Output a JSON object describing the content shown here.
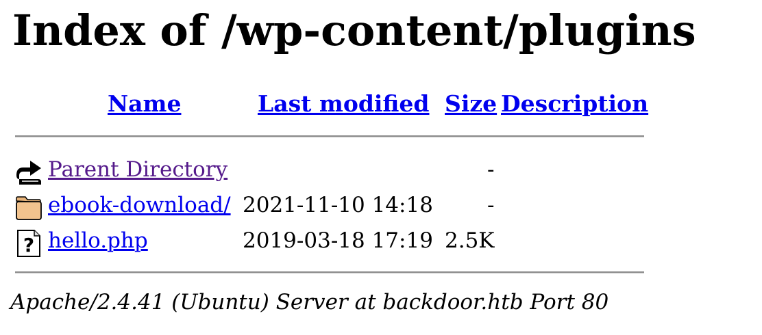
{
  "page": {
    "title": "Index of /wp-content/plugins"
  },
  "columns": {
    "name": "Name",
    "last_modified": "Last modified",
    "size": "Size",
    "description": "Description"
  },
  "rows": [
    {
      "icon": "back-arrow-icon",
      "name": "Parent Directory",
      "last_modified": "",
      "size": "-",
      "description": ""
    },
    {
      "icon": "folder-icon",
      "name": "ebook-download/",
      "last_modified": "2021-11-10 14:18",
      "size": "-",
      "description": ""
    },
    {
      "icon": "unknown-file-icon",
      "name": "hello.php",
      "last_modified": "2019-03-18 17:19",
      "size": "2.5K",
      "description": ""
    }
  ],
  "footer": {
    "address": "Apache/2.4.41 (Ubuntu) Server at backdoor.htb Port 80"
  },
  "colors": {
    "link": "#0000ee",
    "visited_link": "#551a8b",
    "rule": "#8c8c8c"
  }
}
